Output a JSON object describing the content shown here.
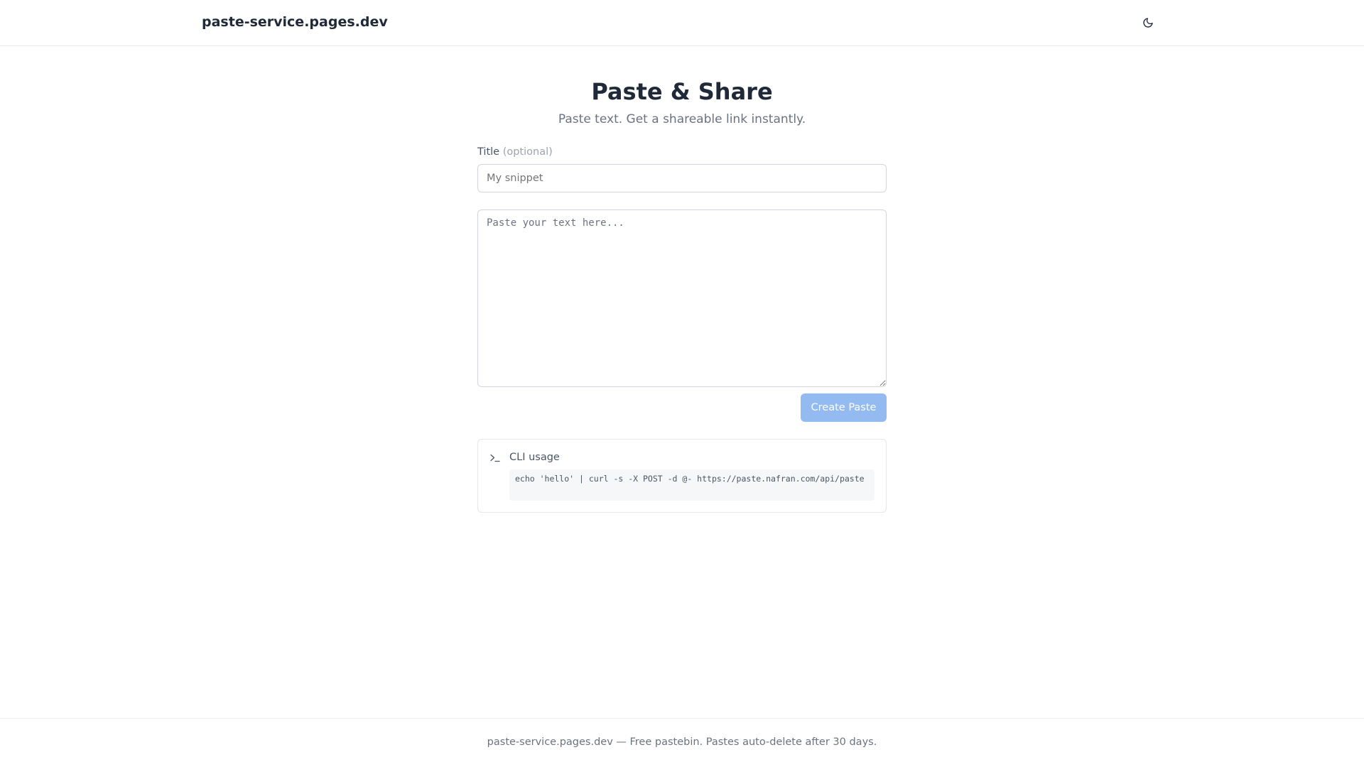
{
  "header": {
    "brand": "paste-service.pages.dev",
    "theme_toggle_icon": "moon-icon"
  },
  "main": {
    "title": "Paste & Share",
    "subtitle": "Paste text. Get a shareable link instantly.",
    "title_field": {
      "label": "Title",
      "optional_hint": "(optional)",
      "value": "",
      "placeholder": "My snippet"
    },
    "content_field": {
      "value": "",
      "placeholder": "Paste your text here..."
    },
    "create_button": {
      "label": "Create Paste",
      "color": "#93bbf2",
      "disabled": true
    }
  },
  "cli": {
    "icon": "terminal-icon",
    "title": "CLI usage",
    "command": "echo 'hello' | curl -s -X POST -d @- https://paste.nafran.com/api/paste"
  },
  "footer": {
    "text": "paste-service.pages.dev — Free pastebin. Pastes auto-delete after 30 days."
  }
}
